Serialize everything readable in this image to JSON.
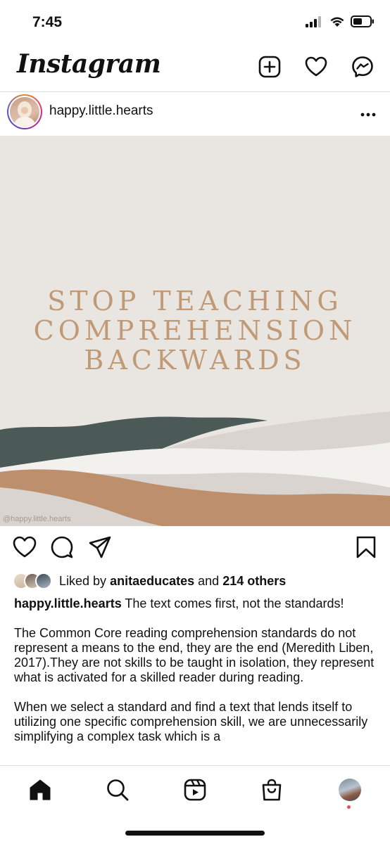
{
  "status_bar": {
    "time": "7:45",
    "icons": [
      "cellular-signal-icon",
      "wifi-icon",
      "battery-icon"
    ]
  },
  "header": {
    "logo": "Instagram",
    "actions": [
      "new-post-icon",
      "heart-icon",
      "messenger-icon"
    ]
  },
  "post": {
    "username": "happy.little.hearts",
    "image": {
      "headline_lines": [
        "STOP TEACHING",
        "COMPREHENSION",
        "BACKWARDS"
      ],
      "watermark": "@happy.little.hearts"
    },
    "actions": [
      "like-icon",
      "comment-icon",
      "share-icon",
      "save-icon"
    ],
    "likes": {
      "prefix": "Liked by",
      "liker": "anitaeducates",
      "middle": "and",
      "others": "214 others"
    },
    "caption": {
      "username": "happy.little.hearts",
      "first_line": "The text comes first, not the standards!",
      "paragraph_1": "The Common Core reading comprehension standards do not represent a means to the end, they are the end (Meredith Liben, 2017).They are not skills to be taught in isolation, they represent what is activated for a skilled reader during reading.",
      "paragraph_2": "When we select a standard and find a text that lends itself to utilizing one specific comprehension skill, we are unnecessarily simplifying a complex task which is a"
    }
  },
  "bottom_nav": [
    "home-icon",
    "search-icon",
    "reels-icon",
    "shop-icon",
    "profile-avatar"
  ],
  "colors": {
    "headline": "#c09a76",
    "image_background": "#e9e5e0",
    "wave_dark": "#4b5a57",
    "wave_tan": "#bd8f6c",
    "wave_light": "#d8d3ce"
  }
}
